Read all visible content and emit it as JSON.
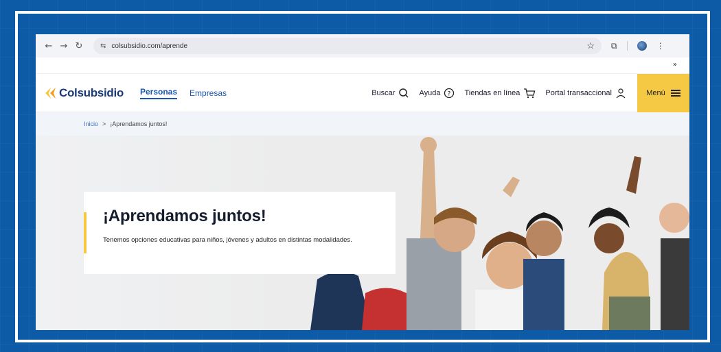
{
  "browser": {
    "url": "colsubsidio.com/aprende",
    "overflow_label": "»"
  },
  "site": {
    "brand": "Colsubsidio",
    "nav": [
      "Personas",
      "Empresas"
    ],
    "utilities": [
      {
        "label": "Buscar",
        "icon": "search-icon"
      },
      {
        "label": "Ayuda",
        "icon": "help-icon"
      },
      {
        "label": "Tiendas en línea",
        "icon": "cart-icon"
      },
      {
        "label": "Portal transaccional",
        "icon": "user-icon"
      }
    ],
    "menu_label": "Menú"
  },
  "breadcrumb": {
    "home": "Inicio",
    "separator": ">",
    "current": "¡Aprendamos juntos!"
  },
  "hero": {
    "title": "¡Aprendamos juntos!",
    "description": "Tenemos opciones educativas para niños, jóvenes y adultos en distintas modalidades."
  },
  "colors": {
    "brand_blue": "#1a3b7a",
    "link_blue": "#1a56b0",
    "accent_yellow": "#f6c944",
    "frame_blue": "#0d5aa6"
  }
}
